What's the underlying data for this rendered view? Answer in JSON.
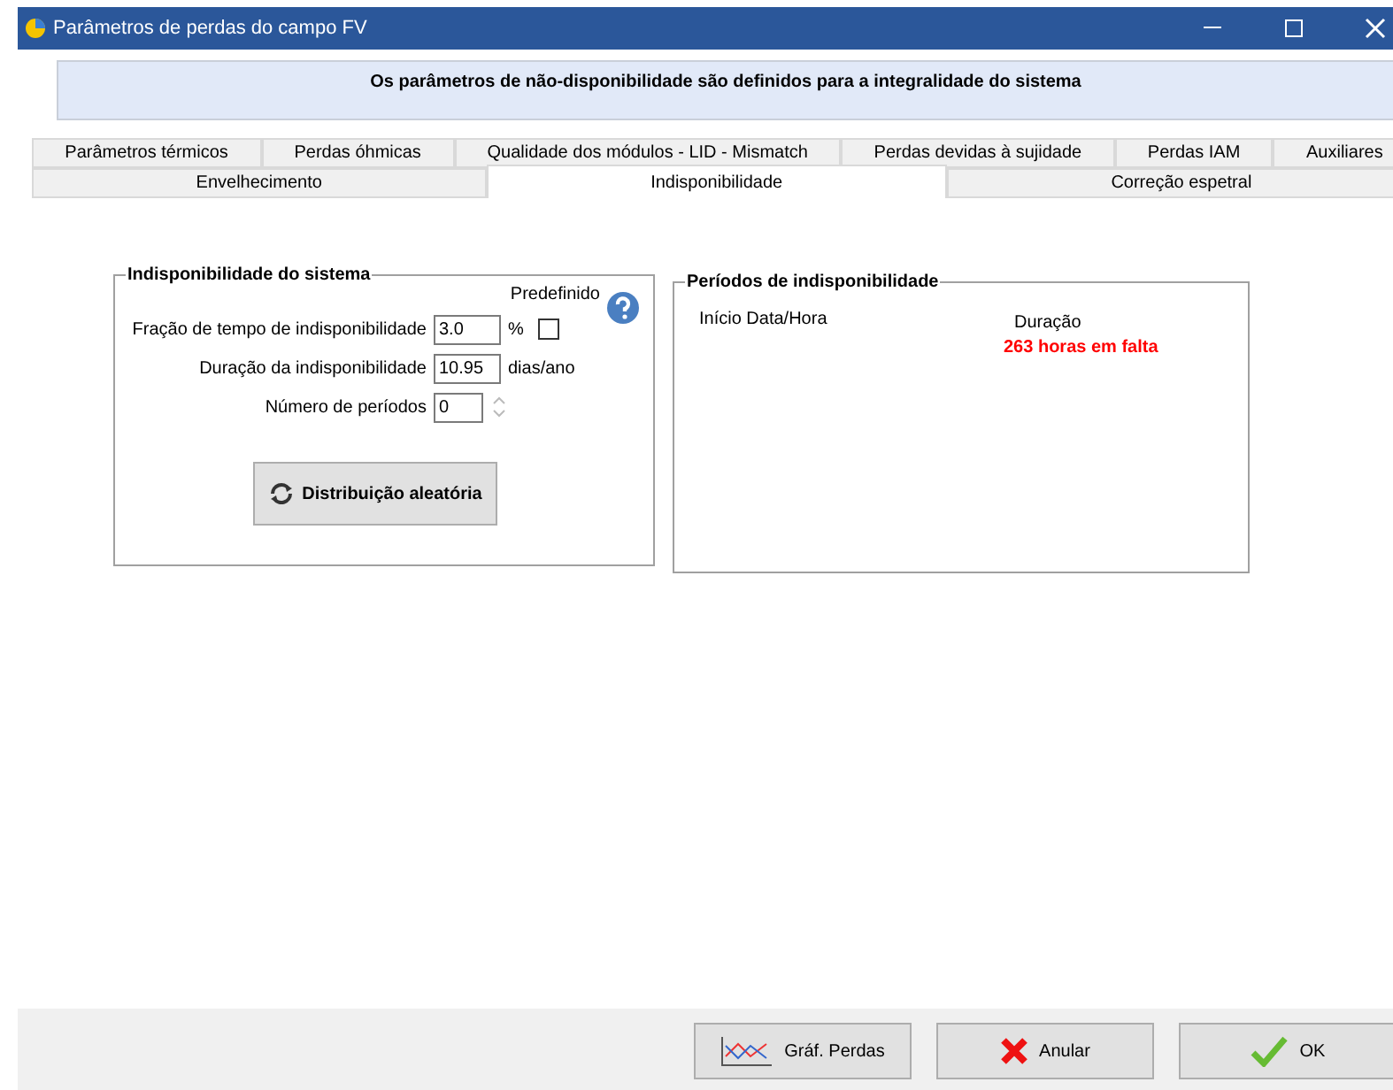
{
  "window": {
    "title": "Parâmetros de perdas do campo FV"
  },
  "banner": "Os parâmetros de não-disponibilidade são definidos para a integralidade do sistema",
  "tab_rows": [
    [
      {
        "label": "Parâmetros térmicos",
        "selected": false
      },
      {
        "label": "Perdas óhmicas",
        "selected": false
      },
      {
        "label": "Qualidade dos módulos - LID - Mismatch",
        "selected": false
      },
      {
        "label": "Perdas devidas à sujidade",
        "selected": false
      },
      {
        "label": "Perdas IAM",
        "selected": false
      },
      {
        "label": "Auxiliares",
        "selected": false
      }
    ],
    [
      {
        "label": "Envelhecimento",
        "selected": false
      },
      {
        "label": "Indisponibilidade",
        "selected": true
      },
      {
        "label": "Correção espetral",
        "selected": false
      }
    ]
  ],
  "system_group": {
    "title": "Indisponibilidade do sistema",
    "predefined_label": "Predefinido",
    "predefined_checked": false,
    "fields": [
      {
        "label": "Fração de tempo de indisponibilidade",
        "value": "3.0",
        "unit": "%",
        "kind": "text"
      },
      {
        "label": "Duração da indisponibilidade",
        "value": "10.95",
        "unit": "dias/ano",
        "kind": "text"
      },
      {
        "label": "Número de períodos",
        "value": "0",
        "kind": "spin"
      }
    ],
    "random_button": "Distribuição aleatória"
  },
  "periods_group": {
    "title": "Períodos de indisponibilidade",
    "columns": [
      "Início Data/Hora",
      "Duração"
    ],
    "missing": "263 horas em falta"
  },
  "buttons": [
    {
      "label": "Gráf. Perdas",
      "kind": "chart"
    },
    {
      "label": "Anular",
      "kind": "cancel"
    },
    {
      "label": "OK",
      "kind": "ok"
    }
  ]
}
